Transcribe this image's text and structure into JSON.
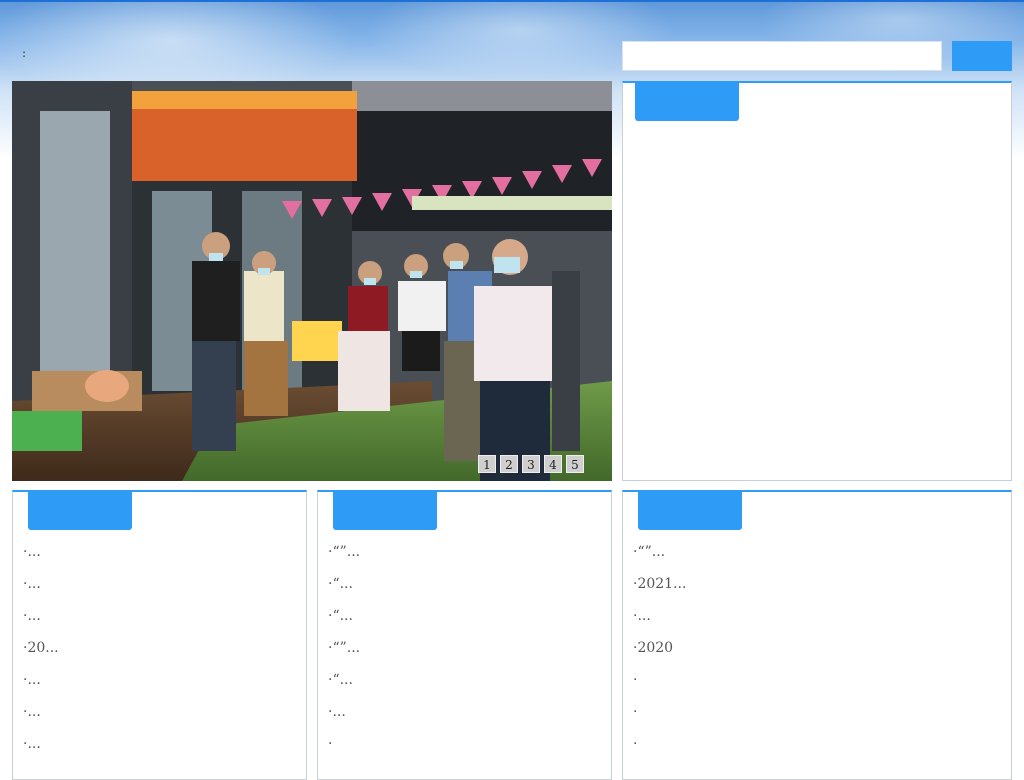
{
  "header": {
    "colon_label": ":",
    "search": {
      "value": "",
      "placeholder": ""
    },
    "search_button_label": ""
  },
  "hero": {
    "pager": [
      "1",
      "2",
      "3",
      "4",
      "5"
    ]
  },
  "right_panel": {
    "title": ""
  },
  "columns": [
    {
      "title": "",
      "items": [
        "·...",
        "·...",
        "·...",
        "·20...",
        "·...",
        "·...",
        "·..."
      ]
    },
    {
      "title": "",
      "items": [
        "·“”...",
        "·“...",
        "·“...",
        "·“”...",
        "·“...",
        "·...",
        "·"
      ]
    },
    {
      "title": "",
      "items": [
        "·“”...",
        "·2021...",
        "·...",
        "·2020",
        "·",
        "·",
        "·"
      ]
    }
  ]
}
